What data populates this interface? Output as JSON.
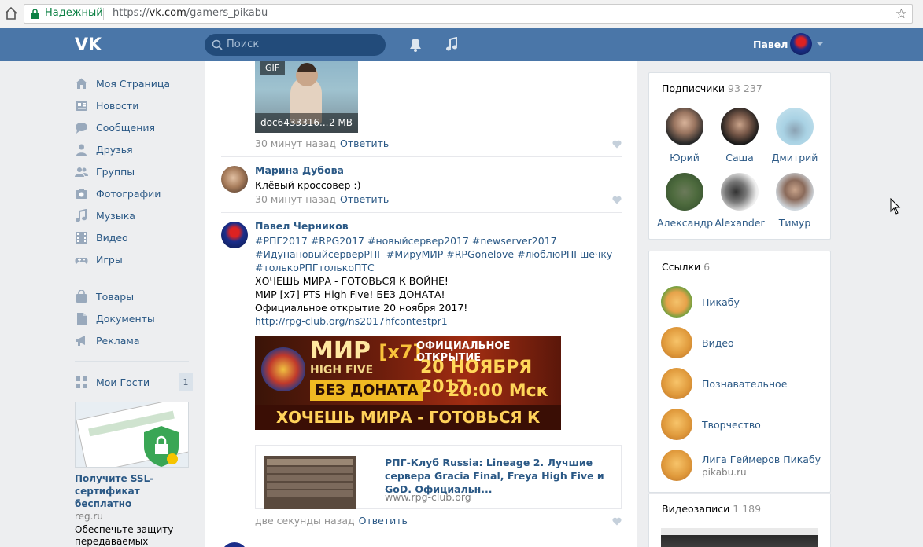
{
  "browser": {
    "secure_label": "Надежный",
    "url_scheme": "https://",
    "url_host": "vk.com",
    "url_path": "/gamers_pikabu"
  },
  "header": {
    "search_placeholder": "Поиск",
    "user_name": "Павел"
  },
  "nav": {
    "items": [
      {
        "label": "Моя Страница",
        "icon": "home-icon"
      },
      {
        "label": "Новости",
        "icon": "news-icon"
      },
      {
        "label": "Сообщения",
        "icon": "messages-icon"
      },
      {
        "label": "Друзья",
        "icon": "friends-icon"
      },
      {
        "label": "Группы",
        "icon": "groups-icon"
      },
      {
        "label": "Фотографии",
        "icon": "camera-icon"
      },
      {
        "label": "Музыка",
        "icon": "music-icon"
      },
      {
        "label": "Видео",
        "icon": "video-icon"
      },
      {
        "label": "Игры",
        "icon": "gamepad-icon"
      }
    ],
    "items2": [
      {
        "label": "Товары",
        "icon": "bag-icon"
      },
      {
        "label": "Документы",
        "icon": "document-icon"
      },
      {
        "label": "Реклама",
        "icon": "megaphone-icon"
      }
    ],
    "guests": {
      "label": "Мои Гости",
      "count": "1",
      "icon": "apps-icon"
    }
  },
  "ad": {
    "title": "Получите SSL-сертификат бесплатно",
    "domain": "reg.ru",
    "text": "Обеспечьте защиту передаваемых данных и получите доверие"
  },
  "feed": {
    "gif": {
      "tag": "GIF",
      "name": "doc6433316...",
      "size": "2 MB"
    },
    "comment1": {
      "time": "30 минут назад",
      "reply": "Ответить"
    },
    "comment2": {
      "author": "Марина Дубова",
      "text": "Клёвый кроссовер :)",
      "time": "30 минут назад",
      "reply": "Ответить"
    },
    "comment3": {
      "author": "Павел Черников",
      "tags_line1": "#РПГ2017 #RPG2017 #новыйсервер2017 #newserver2017",
      "tags_line2": "#ИдунановыйсерверРПГ #МируМИР #RPGonelove #люблюРПГшечку",
      "tags_line3": "#толькоРПГтолькоПТС",
      "text_line1": "ХОЧЕШЬ МИРА - ГОТОВЬСЯ К ВОЙНЕ!",
      "text_line2": "МИР [x7] PTS High Five! БЕЗ ДОНАТА!",
      "text_line3": "Официальное открытие 20 ноября 2017!",
      "link": "http://rpg-club.org/ns2017hfcontestpr1",
      "banner": {
        "world": "МИР",
        "rate": "[x7]",
        "highfive": "HIGH FIVE",
        "nodonate": "БЕЗ ДОНАТА",
        "opening": "ОФИЦИАЛЬНОЕ ОТКРЫТИЕ",
        "date": "20 НОЯБРЯ 2017",
        "time": "20:00 Мск",
        "slogan": "ХОЧЕШЬ МИРА - ГОТОВЬСЯ К ВОЙНЕ"
      },
      "card_title": "РПГ-Клуб Russia: Lineage 2. Лучшие сервера Gracia Final, Freya High Five и GoD. Официальн...",
      "card_domain": "www.rpg-club.org",
      "time": "две секунды назад",
      "reply": "Ответить"
    }
  },
  "subscribers": {
    "title": "Подписчики",
    "count": "93 237",
    "people": [
      "Юрий",
      "Саша",
      "Дмитрий",
      "Александр",
      "Alexander",
      "Тимур"
    ]
  },
  "links": {
    "title": "Ссылки",
    "count": "6",
    "items": [
      {
        "label": "Пикабу",
        "sub": ""
      },
      {
        "label": "Видео",
        "sub": ""
      },
      {
        "label": "Познавательное",
        "sub": ""
      },
      {
        "label": "Творчество",
        "sub": ""
      },
      {
        "label": "Лига Геймеров Пикабу",
        "sub": "pikabu.ru"
      }
    ]
  },
  "videos": {
    "title": "Видеозаписи",
    "count": "1 189"
  },
  "colors": {
    "vk_blue": "#4a76a8",
    "link": "#2a5885",
    "bg": "#edeef0"
  }
}
